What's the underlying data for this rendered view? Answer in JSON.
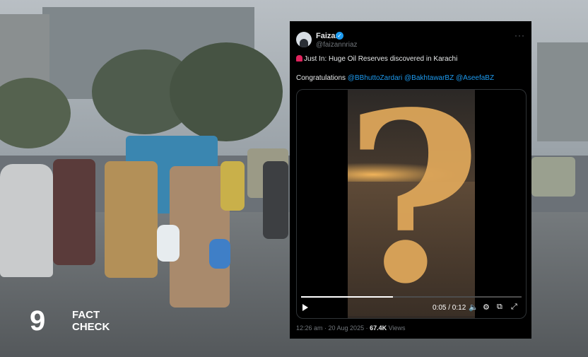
{
  "logo": {
    "number": "9",
    "line1": "FACT",
    "line2": "CHECK"
  },
  "tweet": {
    "name": "Faizan",
    "handle": "@faizannriaz",
    "more_icon": "more-icon",
    "line1": "Just In: Huge Oil Reserves discovered in Karachi",
    "congrats": "Congratulations",
    "mentions": [
      "@BBhuttoZardari",
      "@BakhtawarBZ",
      "@AseefaBZ"
    ],
    "video": {
      "overlay": "?",
      "time": "0:05 / 0:12",
      "progress": 0.416
    },
    "timestamp": "12:26 am · 20 Aug 2025 · ",
    "views_count": "67.4K",
    "views_label": " Views"
  }
}
